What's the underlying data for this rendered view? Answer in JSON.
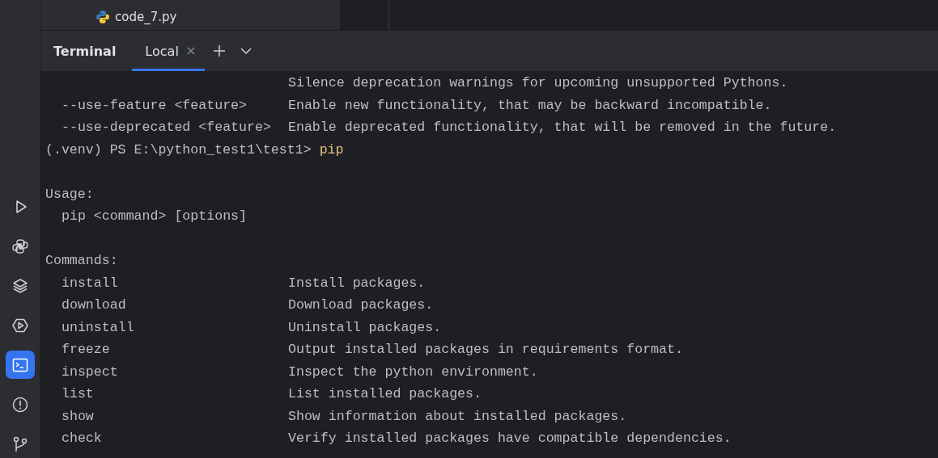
{
  "project_tree": {
    "items": [
      {
        "name": "code_7.py",
        "selected": false
      }
    ]
  },
  "sidebar": {
    "items": [
      {
        "kind": "run",
        "selected": false
      },
      {
        "kind": "python",
        "selected": false
      },
      {
        "kind": "layers",
        "selected": false
      },
      {
        "kind": "services",
        "selected": false
      },
      {
        "kind": "terminal",
        "selected": true
      },
      {
        "kind": "problems",
        "selected": false
      },
      {
        "kind": "git",
        "selected": false
      }
    ]
  },
  "terminal": {
    "title": "Terminal",
    "tabs": [
      {
        "label": "Local",
        "selected": true,
        "closable": true
      }
    ],
    "lines": [
      {
        "kind": "entry",
        "description": "Silence deprecation warnings for upcoming unsupported Pythons."
      },
      {
        "kind": "entry",
        "term": "--use-feature <feature>",
        "description": "Enable new functionality, that may be backward incompatible."
      },
      {
        "kind": "entry",
        "term": "--use-deprecated <feature>",
        "description": "Enable deprecated functionality, that will be removed in the future."
      },
      {
        "kind": "prompt",
        "prompt": "(.venv) PS E:\\python_test1\\test1>",
        "command": "pip"
      },
      {
        "kind": "blank"
      },
      {
        "kind": "heading",
        "text": "Usage:"
      },
      {
        "kind": "indent",
        "text": "pip <command> [options]"
      },
      {
        "kind": "blank"
      },
      {
        "kind": "heading",
        "text": "Commands:"
      },
      {
        "kind": "entry",
        "term": "install",
        "description": "Install packages."
      },
      {
        "kind": "entry",
        "term": "download",
        "description": "Download packages."
      },
      {
        "kind": "entry",
        "term": "uninstall",
        "description": "Uninstall packages."
      },
      {
        "kind": "entry",
        "term": "freeze",
        "description": "Output installed packages in requirements format."
      },
      {
        "kind": "entry",
        "term": "inspect",
        "description": "Inspect the python environment."
      },
      {
        "kind": "entry",
        "term": "list",
        "description": "List installed packages."
      },
      {
        "kind": "entry",
        "term": "show",
        "description": "Show information about installed packages."
      },
      {
        "kind": "entry",
        "term": "check",
        "description": "Verify installed packages have compatible dependencies."
      }
    ]
  }
}
